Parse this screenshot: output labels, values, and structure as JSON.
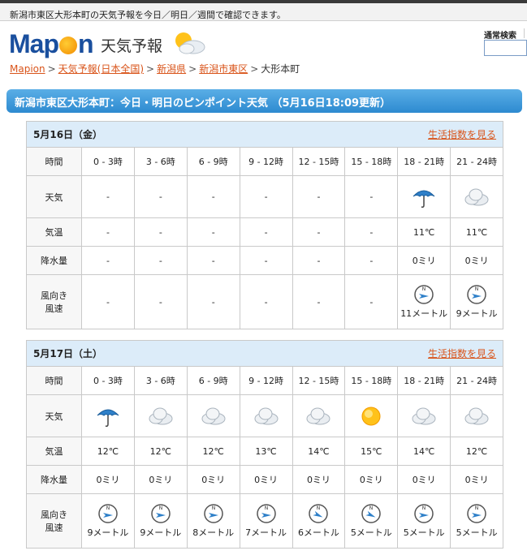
{
  "topbar": {
    "text": "新潟市東区大形本町の天気予報を今日／明日／週間で確認できます。"
  },
  "header": {
    "logo_text_left": "Map",
    "logo_text_right": "n",
    "service_title": "天気予報",
    "search_label": "通常検索",
    "search_value": ""
  },
  "breadcrumb": [
    {
      "label": "Mapion",
      "link": true
    },
    {
      "label": "天気予報(日本全国)",
      "link": true
    },
    {
      "label": "新潟県",
      "link": true
    },
    {
      "label": "新潟市東区",
      "link": true
    },
    {
      "label": "大形本町",
      "link": false
    }
  ],
  "banner": {
    "title": "新潟市東区大形本町：今日・明日のピンポイント天気 （5月16日18:09更新）"
  },
  "labels": {
    "time": "時間",
    "weather": "天気",
    "temp": "気温",
    "rain": "降水量",
    "wind_line1": "風向き",
    "wind_line2": "風速",
    "life_link": "生活指数を見る"
  },
  "hours": [
    "0 - 3時",
    "3 - 6時",
    "6 - 9時",
    "9 - 12時",
    "12 - 15時",
    "15 - 18時",
    "18 - 21時",
    "21 - 24時"
  ],
  "days": [
    {
      "date": "5月16日（金）",
      "weather": [
        "-",
        "-",
        "-",
        "-",
        "-",
        "-",
        "umbrella-icon",
        "cloud-icon"
      ],
      "temp": [
        "-",
        "-",
        "-",
        "-",
        "-",
        "-",
        "11℃",
        "11℃"
      ],
      "rain": [
        "-",
        "-",
        "-",
        "-",
        "-",
        "-",
        "0ミリ",
        "0ミリ"
      ],
      "wind_dir": [
        "",
        "",
        "",
        "",
        "",
        "",
        "E",
        "E"
      ],
      "wind_speed": [
        "-",
        "-",
        "-",
        "-",
        "-",
        "-",
        "11メートル",
        "9メートル"
      ]
    },
    {
      "date": "5月17日（土）",
      "weather": [
        "umbrella-icon",
        "cloud-icon",
        "cloud-icon",
        "cloud-icon",
        "cloud-icon",
        "sun-icon",
        "cloud-icon",
        "cloud-icon"
      ],
      "temp": [
        "12℃",
        "12℃",
        "12℃",
        "13℃",
        "14℃",
        "15℃",
        "14℃",
        "12℃"
      ],
      "rain": [
        "0ミリ",
        "0ミリ",
        "0ミリ",
        "0ミリ",
        "0ミリ",
        "0ミリ",
        "0ミリ",
        "0ミリ"
      ],
      "wind_dir": [
        "E",
        "E",
        "E",
        "E",
        "ESE",
        "ESE",
        "E",
        "E"
      ],
      "wind_speed": [
        "9メートル",
        "9メートル",
        "8メートル",
        "7メートル",
        "6メートル",
        "5メートル",
        "5メートル",
        "5メートル"
      ]
    }
  ],
  "colors": {
    "link": "#d9541a",
    "banner": "#2d8ad0",
    "day_header_bg": "#dcecf9",
    "logo": "#1a4f9e"
  }
}
